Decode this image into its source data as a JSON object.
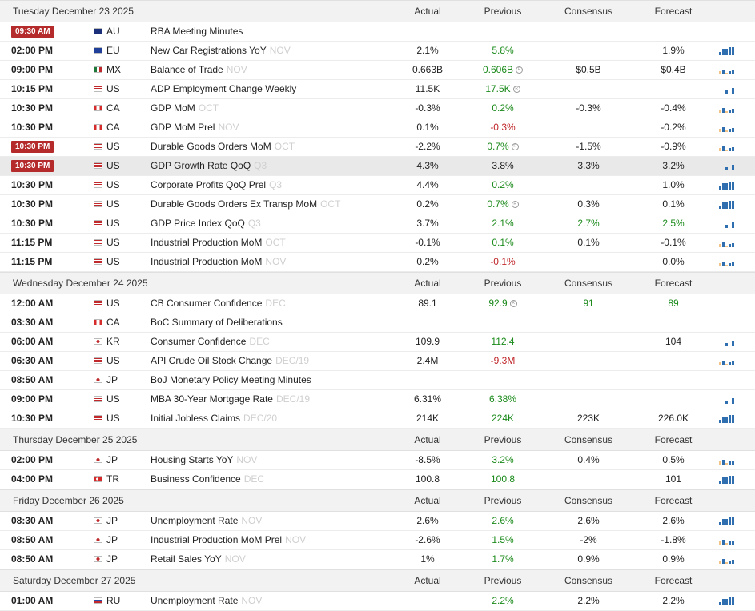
{
  "header_labels": {
    "actual": "Actual",
    "previous": "Previous",
    "consensus": "Consensus",
    "forecast": "Forecast"
  },
  "days": [
    {
      "label": "Tuesday December 23 2025",
      "events": [
        {
          "time": "09:30 AM",
          "badge": true,
          "flag": "au",
          "country": "AU",
          "event": "RBA Meeting Minutes",
          "period": "",
          "actual": "",
          "previous": "",
          "prev_color": "",
          "prev_rev": false,
          "consensus": "",
          "forecast": "",
          "spark": "none"
        },
        {
          "time": "02:00 PM",
          "flag": "eu",
          "country": "EU",
          "event": "New Car Registrations YoY",
          "period": "NOV",
          "actual": "2.1%",
          "previous": "5.8%",
          "prev_color": "g",
          "consensus": "",
          "forecast": "1.9%",
          "spark": "blue"
        },
        {
          "time": "09:00 PM",
          "flag": "mx",
          "country": "MX",
          "event": "Balance of Trade",
          "period": "NOV",
          "actual": "0.663B",
          "previous": "0.606B",
          "prev_color": "g",
          "prev_rev": true,
          "consensus": "$0.5B",
          "forecast": "$0.4B",
          "spark": "mixed"
        },
        {
          "time": "10:15 PM",
          "flag": "us",
          "country": "US",
          "event": "ADP Employment Change Weekly",
          "period": "",
          "actual": "11.5K",
          "previous": "17.5K",
          "prev_color": "g",
          "prev_rev": true,
          "consensus": "",
          "forecast": "",
          "spark": "blue-small"
        },
        {
          "time": "10:30 PM",
          "flag": "ca",
          "country": "CA",
          "event": "GDP MoM",
          "period": "OCT",
          "actual": "-0.3%",
          "previous": "0.2%",
          "prev_color": "g",
          "consensus": "-0.3%",
          "forecast": "-0.4%",
          "spark": "mixed"
        },
        {
          "time": "10:30 PM",
          "flag": "ca",
          "country": "CA",
          "event": "GDP MoM Prel",
          "period": "NOV",
          "actual": "0.1%",
          "previous": "-0.3%",
          "prev_color": "r",
          "consensus": "",
          "forecast": "-0.2%",
          "spark": "mixed"
        },
        {
          "time": "10:30 PM",
          "badge": true,
          "flag": "us",
          "country": "US",
          "event": "Durable Goods Orders MoM",
          "period": "OCT",
          "actual": "-2.2%",
          "previous": "0.7%",
          "prev_color": "g",
          "prev_rev": true,
          "consensus": "-1.5%",
          "forecast": "-0.9%",
          "spark": "mixed"
        },
        {
          "time": "10:30 PM",
          "badge": true,
          "highlight": true,
          "underline": true,
          "flag": "us",
          "country": "US",
          "event": "GDP Growth Rate QoQ",
          "period": "Q3",
          "actual": "4.3%",
          "previous": "3.8%",
          "prev_color": "",
          "consensus": "3.3%",
          "forecast": "3.2%",
          "spark": "blue-small"
        },
        {
          "time": "10:30 PM",
          "flag": "us",
          "country": "US",
          "event": "Corporate Profits QoQ Prel",
          "period": "Q3",
          "actual": "4.4%",
          "previous": "0.2%",
          "prev_color": "g",
          "consensus": "",
          "forecast": "1.0%",
          "spark": "blue"
        },
        {
          "time": "10:30 PM",
          "flag": "us",
          "country": "US",
          "event": "Durable Goods Orders Ex Transp MoM",
          "period": "OCT",
          "actual": "0.2%",
          "previous": "0.7%",
          "prev_color": "g",
          "prev_rev": true,
          "consensus": "0.3%",
          "forecast": "0.1%",
          "spark": "blue"
        },
        {
          "time": "10:30 PM",
          "flag": "us",
          "country": "US",
          "event": "GDP Price Index QoQ",
          "period": "Q3",
          "actual": "3.7%",
          "previous": "2.1%",
          "prev_color": "g",
          "consensus": "2.7%",
          "cons_color": "g",
          "forecast": "2.5%",
          "fore_color": "g",
          "spark": "blue-small"
        },
        {
          "time": "11:15 PM",
          "flag": "us",
          "country": "US",
          "event": "Industrial Production MoM",
          "period": "OCT",
          "actual": "-0.1%",
          "previous": "0.1%",
          "prev_color": "g",
          "consensus": "0.1%",
          "forecast": "-0.1%",
          "spark": "mixed"
        },
        {
          "time": "11:15 PM",
          "flag": "us",
          "country": "US",
          "event": "Industrial Production MoM",
          "period": "NOV",
          "actual": "0.2%",
          "previous": "-0.1%",
          "prev_color": "r",
          "consensus": "",
          "forecast": "0.0%",
          "spark": "mixed"
        }
      ]
    },
    {
      "label": "Wednesday December 24 2025",
      "events": [
        {
          "time": "12:00 AM",
          "flag": "us",
          "country": "US",
          "event": "CB Consumer Confidence",
          "period": "DEC",
          "actual": "89.1",
          "previous": "92.9",
          "prev_color": "g",
          "prev_rev": true,
          "consensus": "91",
          "cons_color": "g",
          "forecast": "89",
          "fore_color": "g",
          "spark": "none"
        },
        {
          "time": "03:30 AM",
          "flag": "ca",
          "country": "CA",
          "event": "BoC Summary of Deliberations",
          "period": "",
          "actual": "",
          "previous": "",
          "prev_color": "",
          "consensus": "",
          "forecast": "",
          "spark": "none"
        },
        {
          "time": "06:00 AM",
          "flag": "kr",
          "country": "KR",
          "event": "Consumer Confidence",
          "period": "DEC",
          "actual": "109.9",
          "previous": "112.4",
          "prev_color": "g",
          "consensus": "",
          "forecast": "104",
          "spark": "blue-small"
        },
        {
          "time": "06:30 AM",
          "flag": "us",
          "country": "US",
          "event": "API Crude Oil Stock Change",
          "period": "DEC/19",
          "actual": "2.4M",
          "previous": "-9.3M",
          "prev_color": "r",
          "consensus": "",
          "forecast": "",
          "spark": "mixed"
        },
        {
          "time": "08:50 AM",
          "flag": "jp",
          "country": "JP",
          "event": "BoJ Monetary Policy Meeting Minutes",
          "period": "",
          "actual": "",
          "previous": "",
          "prev_color": "",
          "consensus": "",
          "forecast": "",
          "spark": "none"
        },
        {
          "time": "09:00 PM",
          "flag": "us",
          "country": "US",
          "event": "MBA 30-Year Mortgage Rate",
          "period": "DEC/19",
          "actual": "6.31%",
          "previous": "6.38%",
          "prev_color": "g",
          "consensus": "",
          "forecast": "",
          "spark": "blue-small"
        },
        {
          "time": "10:30 PM",
          "flag": "us",
          "country": "US",
          "event": "Initial Jobless Claims",
          "period": "DEC/20",
          "actual": "214K",
          "previous": "224K",
          "prev_color": "g",
          "consensus": "223K",
          "forecast": "226.0K",
          "spark": "blue"
        }
      ]
    },
    {
      "label": "Thursday December 25 2025",
      "events": [
        {
          "time": "02:00 PM",
          "flag": "jp",
          "country": "JP",
          "event": "Housing Starts YoY",
          "period": "NOV",
          "actual": "-8.5%",
          "previous": "3.2%",
          "prev_color": "g",
          "consensus": "0.4%",
          "forecast": "0.5%",
          "spark": "mixed"
        },
        {
          "time": "04:00 PM",
          "flag": "tr",
          "country": "TR",
          "event": "Business Confidence",
          "period": "DEC",
          "actual": "100.8",
          "previous": "100.8",
          "prev_color": "g",
          "consensus": "",
          "forecast": "101",
          "spark": "blue"
        }
      ]
    },
    {
      "label": "Friday December 26 2025",
      "events": [
        {
          "time": "08:30 AM",
          "flag": "jp",
          "country": "JP",
          "event": "Unemployment Rate",
          "period": "NOV",
          "actual": "2.6%",
          "previous": "2.6%",
          "prev_color": "g",
          "consensus": "2.6%",
          "forecast": "2.6%",
          "spark": "blue"
        },
        {
          "time": "08:50 AM",
          "flag": "jp",
          "country": "JP",
          "event": "Industrial Production MoM Prel",
          "period": "NOV",
          "actual": "-2.6%",
          "previous": "1.5%",
          "prev_color": "g",
          "consensus": "-2%",
          "forecast": "-1.8%",
          "spark": "mixed"
        },
        {
          "time": "08:50 AM",
          "flag": "jp",
          "country": "JP",
          "event": "Retail Sales YoY",
          "period": "NOV",
          "actual": "1%",
          "previous": "1.7%",
          "prev_color": "g",
          "consensus": "0.9%",
          "forecast": "0.9%",
          "spark": "mixed"
        }
      ]
    },
    {
      "label": "Saturday December 27 2025",
      "events": [
        {
          "time": "01:00 AM",
          "flag": "ru",
          "country": "RU",
          "event": "Unemployment Rate",
          "period": "NOV",
          "actual": "",
          "previous": "2.2%",
          "prev_color": "g",
          "consensus": "2.2%",
          "forecast": "2.2%",
          "spark": "blue"
        }
      ]
    }
  ],
  "colors": {
    "badge": "#b52a2a",
    "positive": "#1a8a1a",
    "negative": "#c0282b",
    "spark_blue": "#2f6fb0",
    "spark_orange": "#f2c48a"
  }
}
